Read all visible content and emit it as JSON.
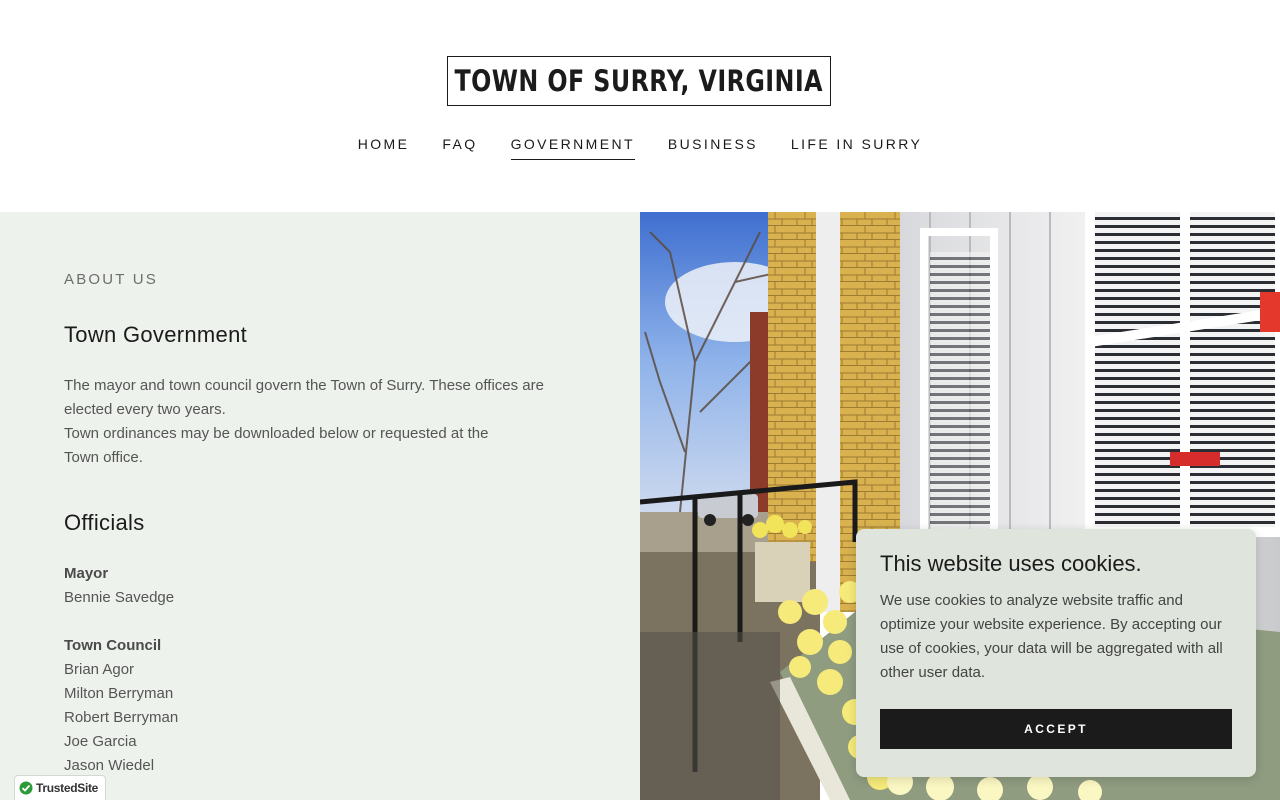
{
  "site": {
    "title": "TOWN OF SURRY, VIRGINIA"
  },
  "nav": {
    "items": [
      {
        "label": "HOME"
      },
      {
        "label": "FAQ"
      },
      {
        "label": "GOVERNMENT"
      },
      {
        "label": "BUSINESS"
      },
      {
        "label": "LIFE IN SURRY"
      }
    ],
    "active": "GOVERNMENT"
  },
  "about": {
    "eyebrow": "ABOUT US",
    "heading": "Town Government",
    "para1": "The mayor and town council govern the Town of Surry. These offices are elected every two years.",
    "para2": "Town ordinances may be downloaded below or requested at the Town office.",
    "officials_heading": "Officials",
    "mayor_label": "Mayor",
    "mayor_name": "Bennie Savedge",
    "council_label": "Town Council",
    "council": [
      "Brian Agor",
      "Milton Berryman",
      "Robert Berryman",
      "Joe Garcia",
      "Jason Wiedel"
    ]
  },
  "cookie": {
    "title": "This website uses cookies.",
    "body": "We use cookies to analyze website traffic and optimize your website experience. By accepting our use of cookies, your data will be aggregated with all other user data.",
    "accept": "ACCEPT"
  },
  "badge": {
    "label": "TrustedSite"
  },
  "colors": {
    "accent": "#1b1b1b",
    "section_bg": "#eef2ed",
    "cookie_bg": "#dfe5dd"
  }
}
